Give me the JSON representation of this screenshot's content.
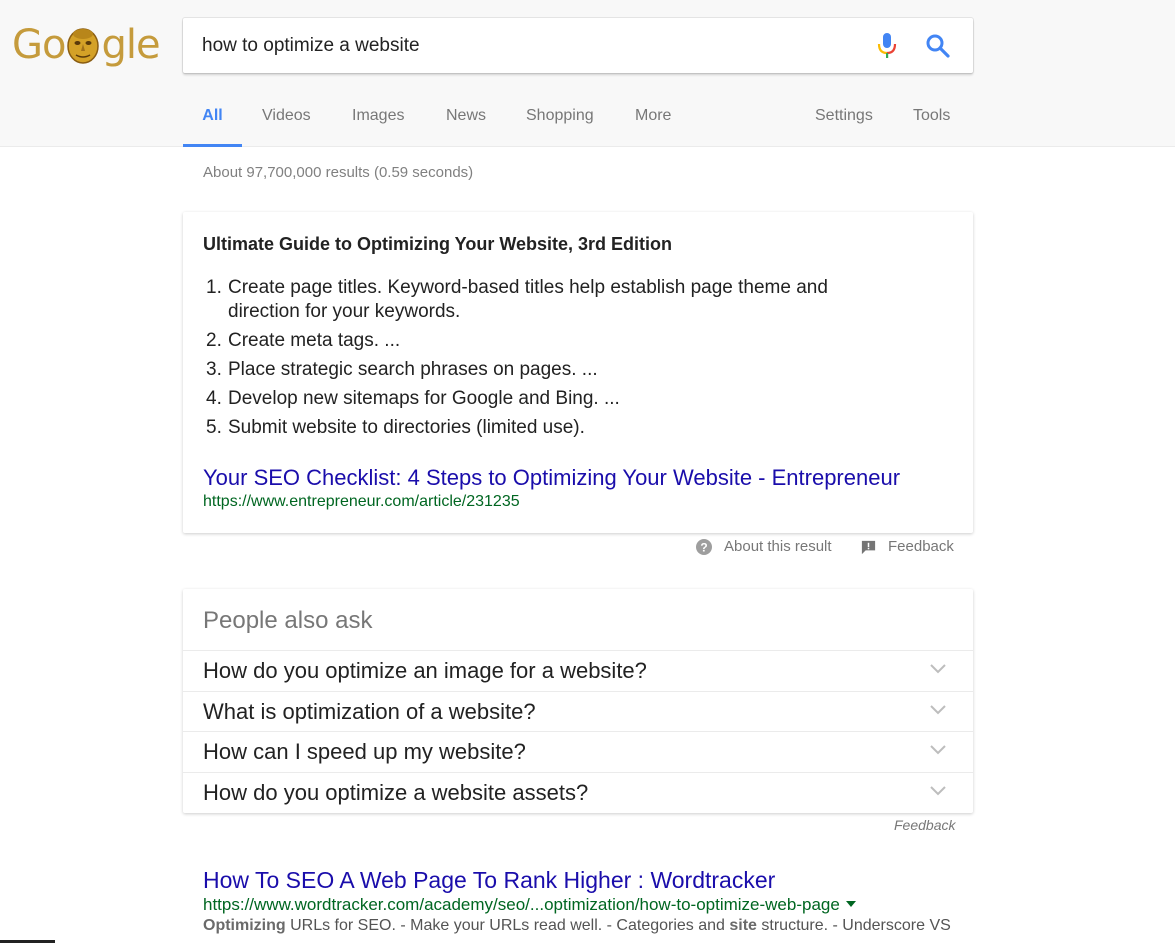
{
  "logo": {
    "text_before": "Go",
    "text_after": "gle",
    "colors": {
      "letters": "#c59b3c",
      "face": "#d4a127"
    }
  },
  "search": {
    "query": "how to optimize a website",
    "icons": [
      "microphone-icon",
      "search-icon"
    ]
  },
  "tabs": [
    {
      "label": "All",
      "active": true
    },
    {
      "label": "Videos"
    },
    {
      "label": "Images"
    },
    {
      "label": "News"
    },
    {
      "label": "Shopping"
    },
    {
      "label": "More"
    },
    {
      "label": "Settings"
    },
    {
      "label": "Tools"
    }
  ],
  "result_stats": "About 97,700,000 results (0.59 seconds)",
  "featured_snippet": {
    "heading": "Ultimate Guide to Optimizing Your Website, 3rd Edition",
    "items": [
      {
        "num": "1.",
        "text": "Create page titles. Keyword-based titles help establish page theme and direction for your keywords."
      },
      {
        "num": "2.",
        "text": "Create meta tags. ..."
      },
      {
        "num": "3.",
        "text": "Place strategic search phrases on pages. ..."
      },
      {
        "num": "4.",
        "text": "Develop new sitemaps for Google and Bing. ..."
      },
      {
        "num": "5.",
        "text": "Submit website to directories (limited use)."
      }
    ],
    "link_title": "Your SEO Checklist: 4 Steps to Optimizing Your Website - Entrepreneur",
    "link_url": "https://www.entrepreneur.com/article/231235",
    "about_label": "About this result",
    "feedback_label": "Feedback"
  },
  "people_also_ask": {
    "title": "People also ask",
    "questions": [
      "How do you optimize an image for a website?",
      "What is optimization of a website?",
      "How can I speed up my website?",
      "How do you optimize a website assets?"
    ],
    "feedback_label": "Feedback"
  },
  "result": {
    "title": "How To SEO A Web Page To Rank Higher : Wordtracker",
    "url": "https://www.wordtracker.com/academy/seo/...optimization/how-to-optimize-web-page",
    "desc_parts": {
      "b1": "Optimizing",
      "t1": " URLs for SEO. - Make your URLs read well. - Categories and ",
      "b2": "site",
      "t2": " structure. - Underscore VS"
    }
  },
  "colors": {
    "accent": "#4285f4",
    "link": "#1a0dab",
    "url_green": "#006621",
    "muted": "#777777"
  }
}
